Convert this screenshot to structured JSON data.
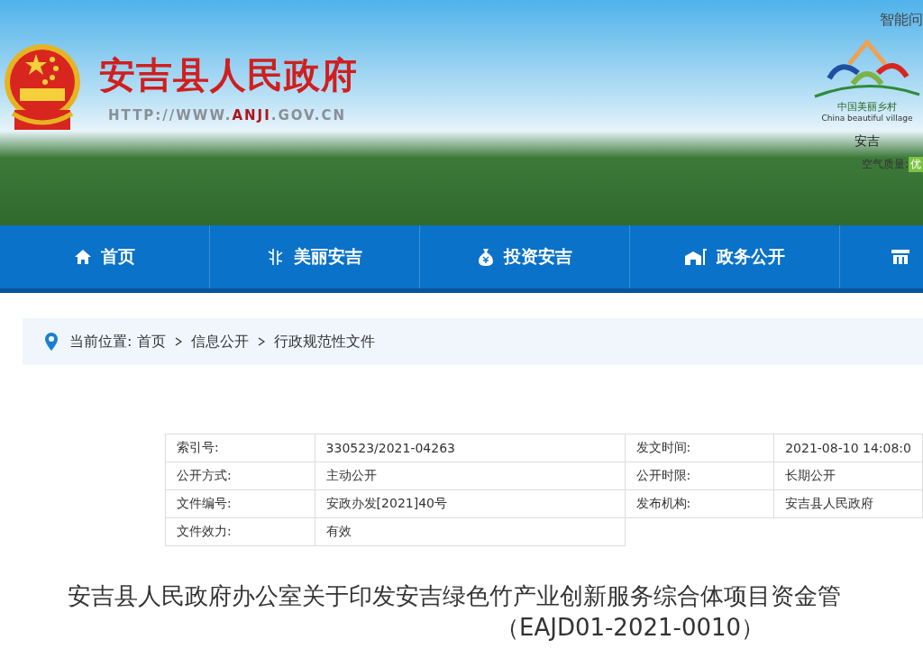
{
  "header": {
    "site_name": "安吉县人民政府",
    "url": "HTTP://WWW.**ANJI**.GOV.CN",
    "qa_link": "智能问",
    "logo_text": "中国美丽乡村",
    "logo_subtext": "China beautiful village",
    "town": "安吉",
    "air_label": "空气质量:",
    "air_value": "优"
  },
  "nav": [
    {
      "label": "首页"
    },
    {
      "label": "美丽安吉"
    },
    {
      "label": "投资安吉"
    },
    {
      "label": "政务公开"
    }
  ],
  "breadcrumb": {
    "label": "当前位置:",
    "items": [
      "首页",
      "信息公开",
      "行政规范性文件"
    ]
  },
  "info_table": [
    [
      "索引号:",
      "330523/2021-04263",
      "发文时间:",
      "2021-08-10 14:08:0"
    ],
    [
      "公开方式:",
      "主动公开",
      "公开时限:",
      "长期公开"
    ],
    [
      "文件编号:",
      "安政办发[2021]40号",
      "发布机构:",
      "安吉县人民政府"
    ],
    [
      "文件效力:",
      "有效"
    ]
  ],
  "document_title": [
    "安吉县人民政府办公室关于印发安吉绿色竹产业创新服务综合体项目资金管",
    "（EAJD01-2021-0010）"
  ]
}
